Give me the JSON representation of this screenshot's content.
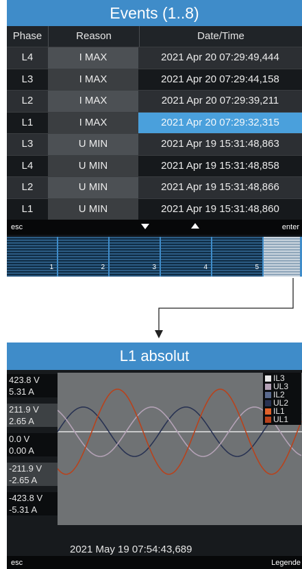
{
  "events_screen": {
    "title": "Events (1..8)",
    "columns": [
      "Phase",
      "Reason",
      "Date/Time"
    ],
    "rows": [
      {
        "phase": "L4",
        "reason": "I MAX",
        "datetime": "2021 Apr 20 07:29:49,444"
      },
      {
        "phase": "L3",
        "reason": "I MAX",
        "datetime": "2021 Apr 20 07:29:44,158"
      },
      {
        "phase": "L2",
        "reason": "I MAX",
        "datetime": "2021 Apr 20 07:29:39,211"
      },
      {
        "phase": "L1",
        "reason": "I MAX",
        "datetime": "2021 Apr 20 07:29:32,315"
      },
      {
        "phase": "L3",
        "reason": "U MIN",
        "datetime": "2021 Apr 19 15:31:48,863"
      },
      {
        "phase": "L4",
        "reason": "U MIN",
        "datetime": "2021 Apr 19 15:31:48,858"
      },
      {
        "phase": "L2",
        "reason": "U MIN",
        "datetime": "2021 Apr 19 15:31:48,866"
      },
      {
        "phase": "L1",
        "reason": "U MIN",
        "datetime": "2021 Apr 19 15:31:48,860"
      }
    ],
    "selected_row": 3,
    "keybar": {
      "esc": "esc",
      "down_icon": "triangle-down-icon",
      "up_icon": "triangle-up-icon",
      "enter": "enter"
    },
    "function_keys": [
      "1",
      "2",
      "3",
      "4",
      "5"
    ]
  },
  "waveform_screen": {
    "title": "L1 absolut",
    "y_labels": [
      {
        "text": "423.8 V"
      },
      {
        "text": "5.31 A"
      },
      {
        "text": "211.9 V"
      },
      {
        "text": "2.65 A"
      },
      {
        "text": "0.0 V"
      },
      {
        "text": "0.00 A"
      },
      {
        "text": "-211.9 V"
      },
      {
        "text": "-2.65 A"
      },
      {
        "text": "-423.8 V"
      },
      {
        "text": "-5.31 A"
      }
    ],
    "legend": [
      {
        "label": "IL3",
        "color": "#e8e8e8"
      },
      {
        "label": "UL3",
        "color": "#b4a2b6"
      },
      {
        "label": "IL2",
        "color": "#5a6a8e"
      },
      {
        "label": "UL2",
        "color": "#283252"
      },
      {
        "label": "IL1",
        "color": "#e2622a"
      },
      {
        "label": "UL1",
        "color": "#b8421c"
      }
    ],
    "timestamp": "2021 May 19 07:54:43,689",
    "keybar": {
      "esc": "esc",
      "legend": "Legende"
    }
  },
  "colors": {
    "accent": "#3f8cc9",
    "selection": "#4aa0dc"
  }
}
